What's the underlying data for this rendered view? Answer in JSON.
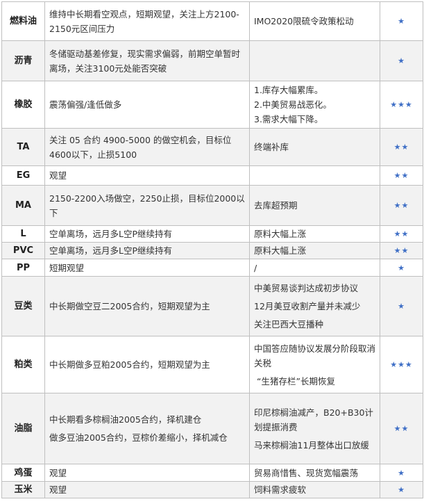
{
  "rows": [
    {
      "name": "燃料油",
      "view": [
        "维持中长期看空观点，短期观望，关注上方2100-2150元区间压力"
      ],
      "logic": [
        "IMO2020限硫令政策松动"
      ],
      "stars": "★"
    },
    {
      "name": "沥青",
      "view": [
        "冬储驱动基差修复，现实需求偏弱，前期空单暂时离场，关注3100元处能否突破"
      ],
      "logic": [],
      "stars": "★"
    },
    {
      "name": "橡胶",
      "view": [
        "震荡偏强/逢低做多"
      ],
      "logic": [
        "1.库存大幅累库。",
        "2.中美贸易战恶化。",
        "3.需求大幅下降。"
      ],
      "stars": "★★★"
    },
    {
      "name": "TA",
      "view": [
        "关注 05 合约 4900-5000 的做空机会，目标位4600以下，止损5100"
      ],
      "logic": [
        "终端补库"
      ],
      "stars": "★★"
    },
    {
      "name": "EG",
      "view": [
        "观望"
      ],
      "logic": [],
      "stars": "★★"
    },
    {
      "name": "MA",
      "view": [
        "2150-2200入场做空，2250止损，目标位2000以下"
      ],
      "logic": [
        "去库超预期"
      ],
      "stars": "★★"
    },
    {
      "name": "L",
      "view": [
        "空单离场，远月多L空P继续持有"
      ],
      "logic": [
        "原料大幅上涨"
      ],
      "stars": "★★"
    },
    {
      "name": "PVC",
      "view": [
        "空单离场，远月多L空P继续持有"
      ],
      "logic": [
        "原料大幅上涨"
      ],
      "stars": "★★"
    },
    {
      "name": "PP",
      "view": [
        "短期观望"
      ],
      "logic": [
        "/"
      ],
      "stars": "★"
    },
    {
      "name": "豆类",
      "view": [
        "中长期做空豆二2005合约，短期观望为主"
      ],
      "logic": [
        "中美贸易谈判达成初步协议",
        "12月美豆收割产量并未减少",
        "关注巴西大豆播种"
      ],
      "stars": "★"
    },
    {
      "name": "粕类",
      "view": [
        "中长期做多豆粕2005合约，短期观望为主"
      ],
      "logic": [
        "中国答应随协议发展分阶段取消关税",
        "“生猪存栏”长期恢复"
      ],
      "stars": "★★★"
    },
    {
      "name": "油脂",
      "view": [
        "中长期看多棕榈油2005合约，择机建仓",
        "做多豆油2005合约，豆棕价差缩小，择机减仓"
      ],
      "logic": [
        "印尼棕榈油减产，B20+B30计划提振消费",
        "马来棕榈油11月整体出口放缓"
      ],
      "stars": "★★"
    },
    {
      "name": "鸡蛋",
      "view": [
        "观望"
      ],
      "logic": [
        "贸易商惜售、现货宽幅震荡"
      ],
      "stars": "★"
    },
    {
      "name": "玉米",
      "view": [
        "观望"
      ],
      "logic": [
        "饲料需求疲软"
      ],
      "stars": "★"
    }
  ]
}
